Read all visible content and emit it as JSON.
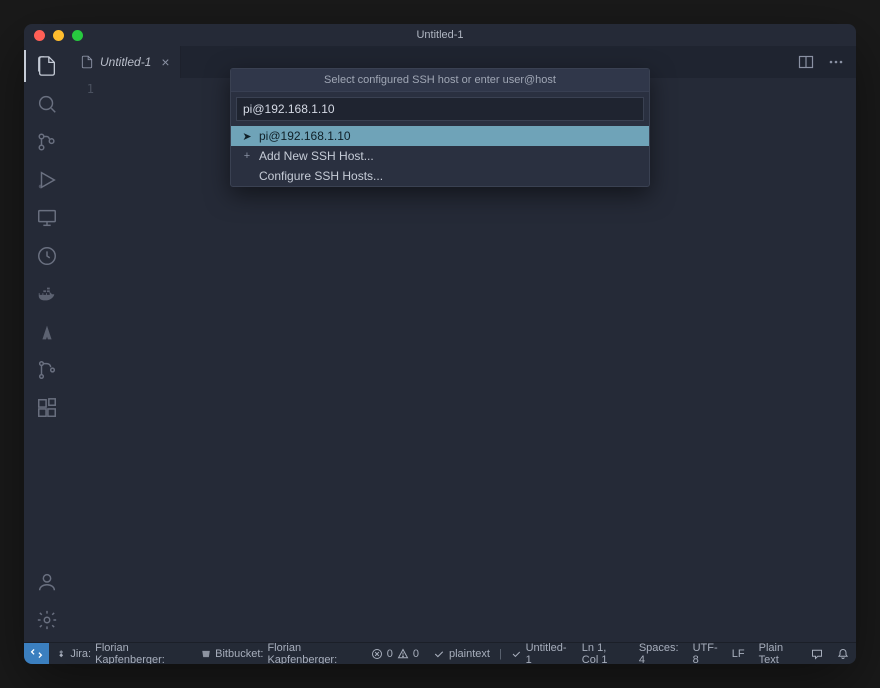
{
  "title": "Untitled-1",
  "tab": {
    "label": "Untitled-1",
    "lineNumber": "1"
  },
  "quickpick": {
    "title": "Select configured SSH host or enter user@host",
    "input": "pi@192.168.1.10",
    "items": [
      {
        "label": "pi@192.168.1.10",
        "prefix": "arrow"
      },
      {
        "label": "Add New SSH Host...",
        "prefix": "plus"
      },
      {
        "label": "Configure SSH Hosts...",
        "prefix": "none"
      }
    ]
  },
  "status": {
    "jiraLabel": "Jira:",
    "jiraUser": "Florian Kapfenberger:",
    "bitbucketLabel": "Bitbucket:",
    "bitbucketUser": "Florian Kapfenberger:",
    "errors": "0",
    "warnings": "0",
    "checkLabel1": "plaintext",
    "checkLabel2": "Untitled-1",
    "lnCol": "Ln 1, Col 1",
    "spaces": "Spaces: 4",
    "encoding": "UTF-8",
    "eol": "LF",
    "language": "Plain Text"
  }
}
